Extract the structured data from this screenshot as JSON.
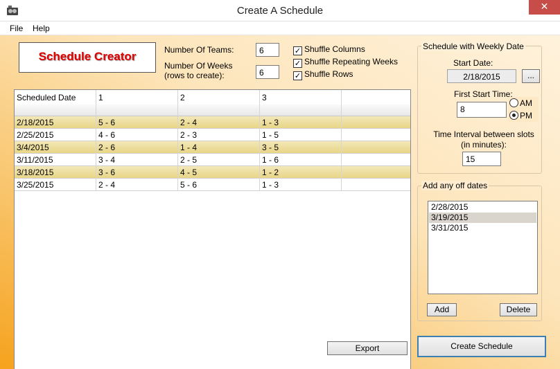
{
  "window": {
    "title": "Create A Schedule",
    "close_glyph": "✕"
  },
  "menu": {
    "items": [
      "File",
      "Help"
    ]
  },
  "logo": {
    "text": "Schedule Creator"
  },
  "teams": {
    "label": "Number Of Teams:",
    "value": "6"
  },
  "weeks": {
    "label_line1": "Number Of Weeks",
    "label_line2": "(rows to create):",
    "value": "6"
  },
  "shuffle": [
    {
      "label": "Shuffle Columns",
      "checked": true
    },
    {
      "label": "Shuffle Repeating Weeks",
      "checked": true
    },
    {
      "label": "Shuffle Rows",
      "checked": true
    }
  ],
  "check_glyph": "✓",
  "grid": {
    "columns": [
      "Scheduled Date",
      "1",
      "2",
      "3",
      ""
    ],
    "rows": [
      [
        "2/18/2015",
        "5 - 6",
        "2 - 4",
        "1 - 3",
        ""
      ],
      [
        "2/25/2015",
        "4 - 6",
        "2 - 3",
        "1 - 5",
        ""
      ],
      [
        "3/4/2015",
        "2 - 6",
        "1 - 4",
        "3 - 5",
        ""
      ],
      [
        "3/11/2015",
        "3 - 4",
        "2 - 5",
        "1 - 6",
        ""
      ],
      [
        "3/18/2015",
        "3 - 6",
        "4 - 5",
        "1 - 2",
        ""
      ],
      [
        "3/25/2015",
        "2 - 4",
        "5 - 6",
        "1 - 3",
        ""
      ]
    ]
  },
  "export_button": "Export",
  "weekly": {
    "group_title": "Schedule with Weekly Date",
    "start_date_label": "Start Date:",
    "start_date_value": "2/18/2015",
    "browse_label": "...",
    "first_start_label": "First Start Time:",
    "first_start_value": "8",
    "am_label": "AM",
    "pm_label": "PM",
    "selected_period": "PM",
    "interval_label_line1": "Time Interval between slots",
    "interval_label_line2": "(in minutes):",
    "interval_value": "15"
  },
  "offdates": {
    "group_title": "Add any off dates",
    "items": [
      "2/28/2015",
      "3/19/2015",
      "3/31/2015"
    ],
    "selected_index": 1,
    "add_label": "Add",
    "delete_label": "Delete"
  },
  "create_button": "Create Schedule"
}
